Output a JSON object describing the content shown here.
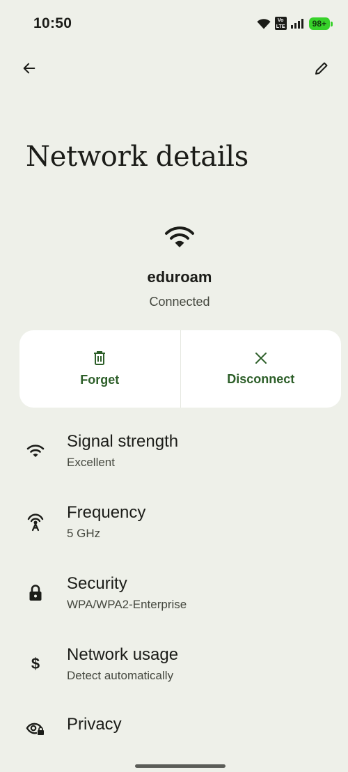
{
  "status_bar": {
    "time": "10:50",
    "volte_top": "Vo",
    "volte_bottom": "LTE",
    "battery": "98+"
  },
  "page": {
    "title": "Network details"
  },
  "network": {
    "name": "eduroam",
    "status": "Connected"
  },
  "actions": [
    {
      "label": "Forget",
      "icon": "trash-icon"
    },
    {
      "label": "Disconnect",
      "icon": "close-icon"
    }
  ],
  "details": [
    {
      "title": "Signal strength",
      "value": "Excellent",
      "icon": "wifi-signal-icon"
    },
    {
      "title": "Frequency",
      "value": "5 GHz",
      "icon": "antenna-icon"
    },
    {
      "title": "Security",
      "value": "WPA/WPA2-Enterprise",
      "icon": "lock-icon"
    },
    {
      "title": "Network usage",
      "value": "Detect automatically",
      "icon": "dollar-icon"
    },
    {
      "title": "Privacy",
      "icon": "privacy-icon"
    }
  ],
  "colors": {
    "background": "#eef0e9",
    "accent": "#2c5e28",
    "battery": "#37d22a"
  }
}
